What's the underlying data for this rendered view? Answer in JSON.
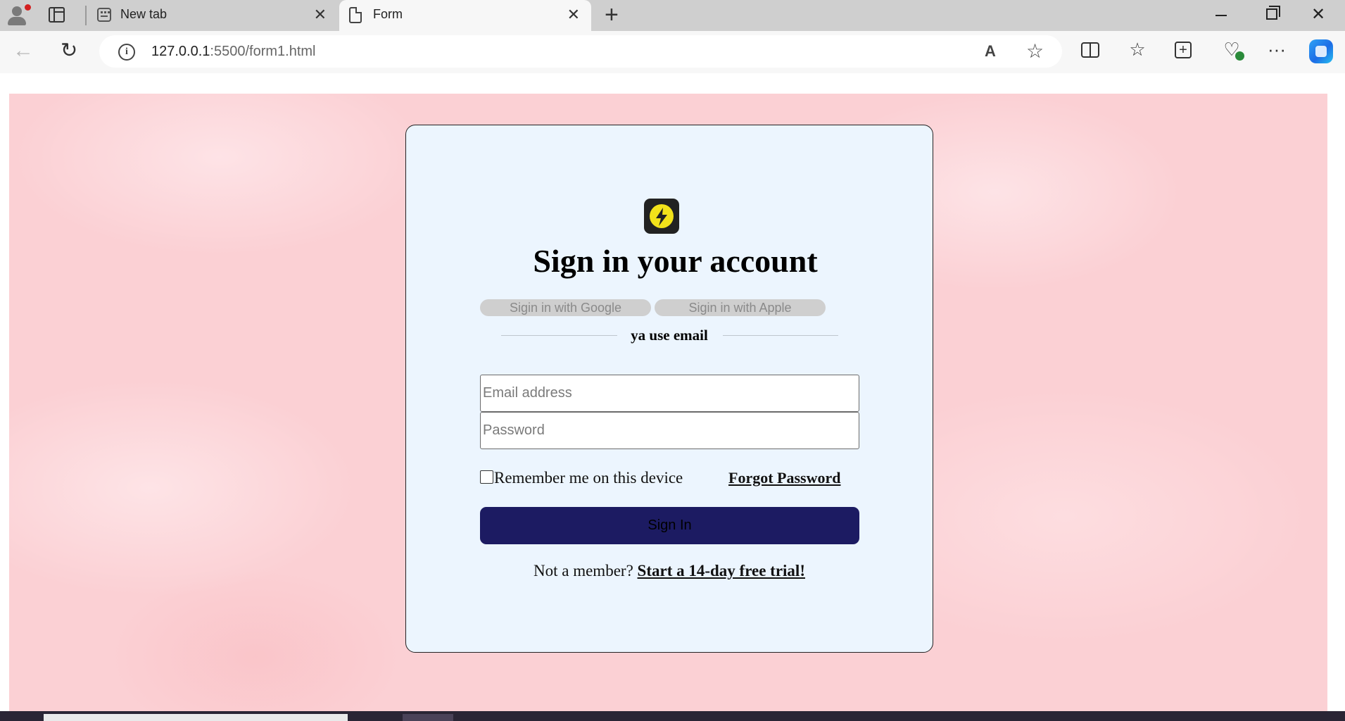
{
  "browser": {
    "tabs": [
      {
        "title": "New tab",
        "close": "✕"
      },
      {
        "title": "Form",
        "close": "✕"
      }
    ],
    "new_tab": "+",
    "address": {
      "host": "127.0.0.1",
      "rest": ":5500/form1.html"
    },
    "window": {
      "close": "✕"
    },
    "icons": {
      "back": "←",
      "reload": "↻",
      "read_aloud": "A",
      "favorite": "☆",
      "favorites": "☆",
      "collections": "+",
      "health": "♡",
      "more": "···",
      "info": "i"
    }
  },
  "form": {
    "title": "Sign in your account",
    "google_label": "Sigin in with Google",
    "apple_label": "Sigin in with Apple",
    "divider_text": "ya use email",
    "email_placeholder": "Email address",
    "password_placeholder": "Password",
    "remember_label": "Remember me on this device",
    "forgot_label": "Forgot Password",
    "signin_label": "Sign In",
    "footer_text": "Not a member? ",
    "trial_link": "Start a 14-day free trial!"
  },
  "colors": {
    "card_bg": "#ecf5fe",
    "page_bg": "#fbd0d4",
    "signin_bg": "#1c1b62",
    "logo_bolt": "#f2e21a"
  }
}
